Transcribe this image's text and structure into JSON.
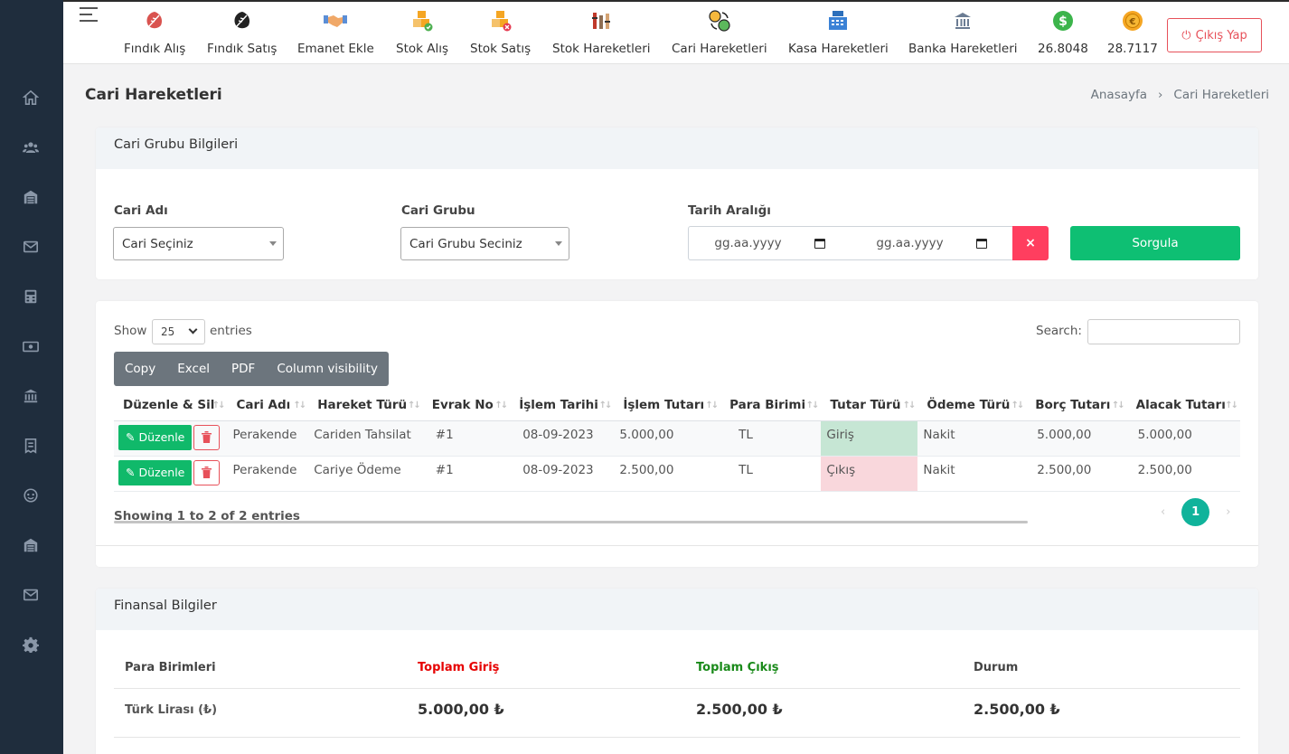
{
  "nav": {
    "items": [
      {
        "label": "Fındık Alış",
        "icon": "hazelnut-leaf-icon"
      },
      {
        "label": "Fındık Satış",
        "icon": "hazelnut-leaf-dark-icon"
      },
      {
        "label": "Emanet Ekle",
        "icon": "handshake-icon"
      },
      {
        "label": "Stok Alış",
        "icon": "boxes-in-icon"
      },
      {
        "label": "Stok Satış",
        "icon": "boxes-out-icon"
      },
      {
        "label": "Stok Hareketleri",
        "icon": "stock-movements-icon"
      },
      {
        "label": "Cari Hareketleri",
        "icon": "exchange-icon"
      },
      {
        "label": "Kasa Hareketleri",
        "icon": "cash-register-icon"
      },
      {
        "label": "Banka Hareketleri",
        "icon": "bank-icon"
      },
      {
        "label": "26.8048",
        "icon": "dollar-coin-icon"
      },
      {
        "label": "28.7117",
        "icon": "euro-coin-icon"
      }
    ],
    "logout_label": "Çıkış Yap"
  },
  "colors": {
    "sidebar": "#1f2d3d",
    "success": "#0ebf73",
    "danger": "#ff3e5f",
    "teal": "#10b39b"
  },
  "page": {
    "title": "Cari Hareketleri",
    "breadcrumb": {
      "home": "Anasayfa",
      "separator": "›",
      "current": "Cari Hareketleri"
    }
  },
  "filter": {
    "header": "Cari Grubu Bilgileri",
    "cari_label": "Cari Adı",
    "cari_value": "Cari Seçiniz",
    "group_label": "Cari Grubu",
    "group_value": "Cari Grubu Seciniz",
    "date_label": "Tarih Aralığı",
    "date_start_placeholder": "gg.aa.yyyy",
    "date_end_placeholder": "gg.aa.yyyy",
    "clear_label": "×",
    "submit_label": "Sorgula"
  },
  "table": {
    "show_label": "Show",
    "page_length": "25",
    "entries_label": "entries",
    "search_label": "Search:",
    "search_value": "",
    "buttons": [
      "Copy",
      "Excel",
      "PDF",
      "Column visibility"
    ],
    "columns": [
      "Düzenle & Sil",
      "Cari Adı",
      "Hareket Türü",
      "Evrak No",
      "İşlem Tarihi",
      "İşlem Tutarı",
      "Para Birimi",
      "Tutar Türü",
      "Ödeme Türü",
      "Borç Tutarı",
      "Alacak Tutarı"
    ],
    "edit_label": "Düzenle",
    "rows": [
      {
        "cari": "Perakende",
        "hareket": "Cariden Tahsilat",
        "evrak": "#1",
        "tarih": "08-09-2023",
        "tutar": "5.000,00",
        "para": "TL",
        "tur": "Giriş",
        "odeme": "Nakit",
        "borc": "5.000,00",
        "alacak": "5.000,00"
      },
      {
        "cari": "Perakende",
        "hareket": "Cariye Ödeme",
        "evrak": "#1",
        "tarih": "08-09-2023",
        "tutar": "2.500,00",
        "para": "TL",
        "tur": "Çıkış",
        "odeme": "Nakit",
        "borc": "2.500,00",
        "alacak": "2.500,00"
      }
    ],
    "info": "Showing 1 to 2 of 2 entries",
    "pagination": {
      "prev": "‹",
      "current": "1",
      "next": "›"
    }
  },
  "finance": {
    "header": "Finansal Bilgiler",
    "columns": {
      "currency": "Para Birimleri",
      "in": "Toplam Giriş",
      "out": "Toplam Çıkış",
      "status": "Durum"
    },
    "rows": [
      {
        "currency": "Türk Lirası (₺)",
        "in": "5.000,00 ₺",
        "out": "2.500,00 ₺",
        "status": "2.500,00 ₺"
      }
    ]
  }
}
